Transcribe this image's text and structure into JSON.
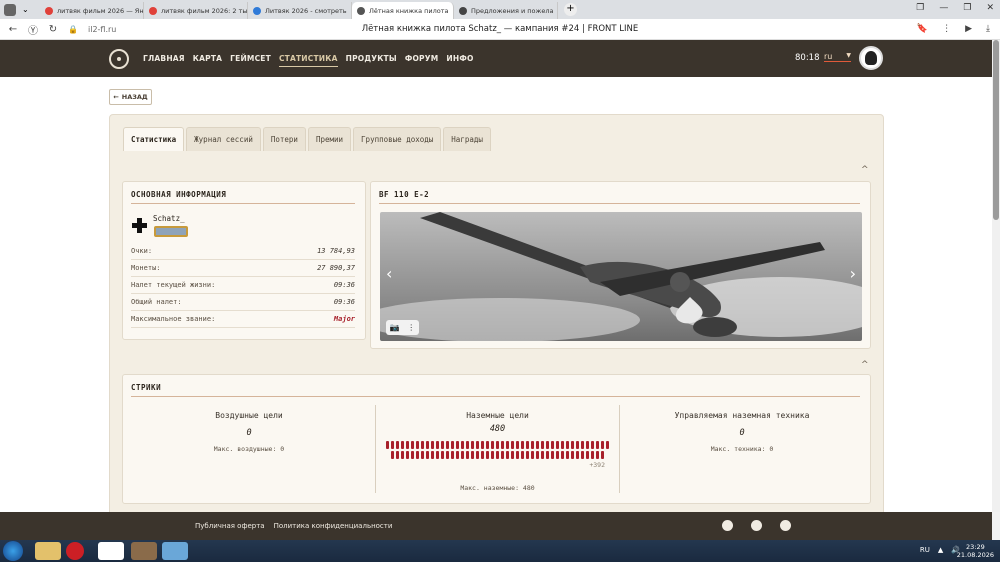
{
  "browser": {
    "tabs": [
      {
        "title": "литвяк фильм 2026 — Ян",
        "color": "#e0413a"
      },
      {
        "title": "литвяк фильм 2026: 2 тыс",
        "color": "#e0413a"
      },
      {
        "title": "Литвяк 2026 - смотреть",
        "color": "#2f7ad8"
      },
      {
        "title": "Лётная книжка пилота",
        "color": "#555555",
        "active": true
      },
      {
        "title": "Предложения и пожела",
        "color": "#444444"
      }
    ],
    "url": "il2-fl.ru",
    "page_title": "Лётная книжка пилота Schatz_ — кампания #24 | FRONT LINE"
  },
  "header": {
    "nav": [
      "ГЛАВНАЯ",
      "КАРТА",
      "ГЕЙМСЕТ",
      "СТАТИСТИКА",
      "ПРОДУКТЫ",
      "ФОРУМ",
      "ИНФО"
    ],
    "active_nav": "СТАТИСТИКА",
    "timer": "80:18",
    "lang": "ru"
  },
  "back_label": "НАЗАД",
  "tabs": [
    "Статистика",
    "Журнал сессий",
    "Потери",
    "Премии",
    "Групповые доходы",
    "Награды"
  ],
  "basic_info": {
    "title": "ОСНОВНАЯ ИНФОРМАЦИЯ",
    "username": "Schatz_",
    "rows": [
      {
        "label": "Очки:",
        "value": "13 784,93"
      },
      {
        "label": "Монеты:",
        "value": "27 890,37"
      },
      {
        "label": "Налет текущей жизни:",
        "value": "09:36"
      },
      {
        "label": "Общий налет:",
        "value": "09:36"
      },
      {
        "label": "Максимальное звание:",
        "value": "Major"
      }
    ]
  },
  "aircraft": {
    "title": "BF 110 E-2"
  },
  "streaks": {
    "title": "СТРИКИ",
    "air": {
      "title": "Воздушные цели",
      "value": "0",
      "max": "Макс. воздушные: 0"
    },
    "ground": {
      "title": "Наземные цели",
      "value": "480",
      "more": "+392",
      "max": "Макс. наземные: 480",
      "bar_count": 88
    },
    "vehicle": {
      "title": "Управляемая наземная техника",
      "value": "0",
      "max": "Макс. техника: 0"
    }
  },
  "footer": {
    "links": [
      "Публичная оферта",
      "Политика конфиденциальности"
    ],
    "icons": [
      "telegram-icon",
      "discord-icon",
      "support-icon"
    ]
  },
  "taskbar": {
    "lang": "RU",
    "time": "23:29",
    "date": "21.08.2026"
  }
}
